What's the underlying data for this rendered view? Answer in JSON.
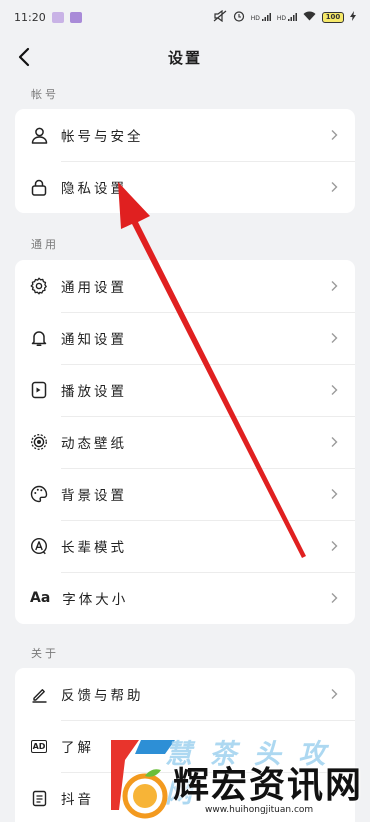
{
  "status_bar": {
    "time": "11:20",
    "hd1": "HD",
    "hd2": "HD",
    "battery": "100"
  },
  "header": {
    "title": "设置"
  },
  "sections": {
    "account": {
      "label": "帐号",
      "items": [
        {
          "label": "帐号与安全",
          "icon": "person-icon"
        },
        {
          "label": "隐私设置",
          "icon": "lock-icon"
        }
      ]
    },
    "general": {
      "label": "通用",
      "items": [
        {
          "label": "通用设置",
          "icon": "gear-icon"
        },
        {
          "label": "通知设置",
          "icon": "bell-icon"
        },
        {
          "label": "播放设置",
          "icon": "play-device-icon"
        },
        {
          "label": "动态壁纸",
          "icon": "live-wallpaper-icon"
        },
        {
          "label": "背景设置",
          "icon": "palette-icon"
        },
        {
          "label": "长辈模式",
          "icon": "elder-mode-icon"
        },
        {
          "label": "字体大小",
          "icon": "font-size-icon",
          "glyph": "Aa"
        }
      ]
    },
    "about": {
      "label": "关于",
      "items": [
        {
          "label": "反馈与帮助",
          "icon": "pen-icon"
        },
        {
          "label": "了解",
          "icon": "ad-icon",
          "glyph": "AD"
        },
        {
          "label": "抖音",
          "icon": "document-icon"
        }
      ]
    }
  },
  "watermark": {
    "top_text": "慧 茶 头 攻 网",
    "main_text": "辉宏资讯网",
    "url": "www.huihongjituan.com"
  },
  "colors": {
    "background": "#f1f2f4",
    "card": "#ffffff",
    "annotation_arrow": "#e02020"
  }
}
